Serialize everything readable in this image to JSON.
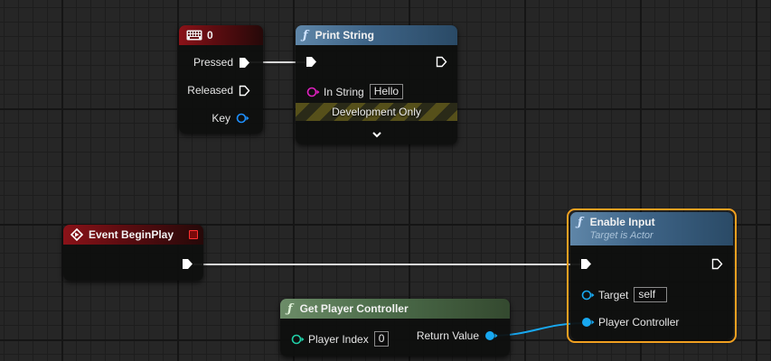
{
  "key_event_node": {
    "title": "0",
    "header_icon": "keyboard-icon",
    "pins": {
      "pressed": "Pressed",
      "released": "Released",
      "key": "Key"
    }
  },
  "print_string_node": {
    "title": "Print String",
    "header_icon": "function-icon",
    "in_string_label": "In String",
    "in_string_value": "Hello",
    "dev_only_label": "Development Only"
  },
  "event_begin_play_node": {
    "title": "Event BeginPlay",
    "header_icon": "event-diamond-icon"
  },
  "enable_input_node": {
    "title": "Enable Input",
    "subtitle": "Target is Actor",
    "header_icon": "function-icon",
    "target_label": "Target",
    "target_value": "self",
    "player_controller_label": "Player Controller",
    "selected": true
  },
  "get_player_controller_node": {
    "title": "Get Player Controller",
    "header_icon": "function-icon",
    "player_index_label": "Player Index",
    "player_index_value": "0",
    "return_value_label": "Return Value"
  },
  "colors": {
    "event_header": "#8a1218",
    "function_header": "#5f86a8",
    "pure_function_header": "#6c8c68",
    "selection_outline": "#f0a020",
    "string_pin": "#e020c0",
    "struct_pin": "#1e90ff",
    "object_pin": "#18a8f0",
    "int_pin": "#20d0a8",
    "exec_pin": "#ffffff"
  }
}
